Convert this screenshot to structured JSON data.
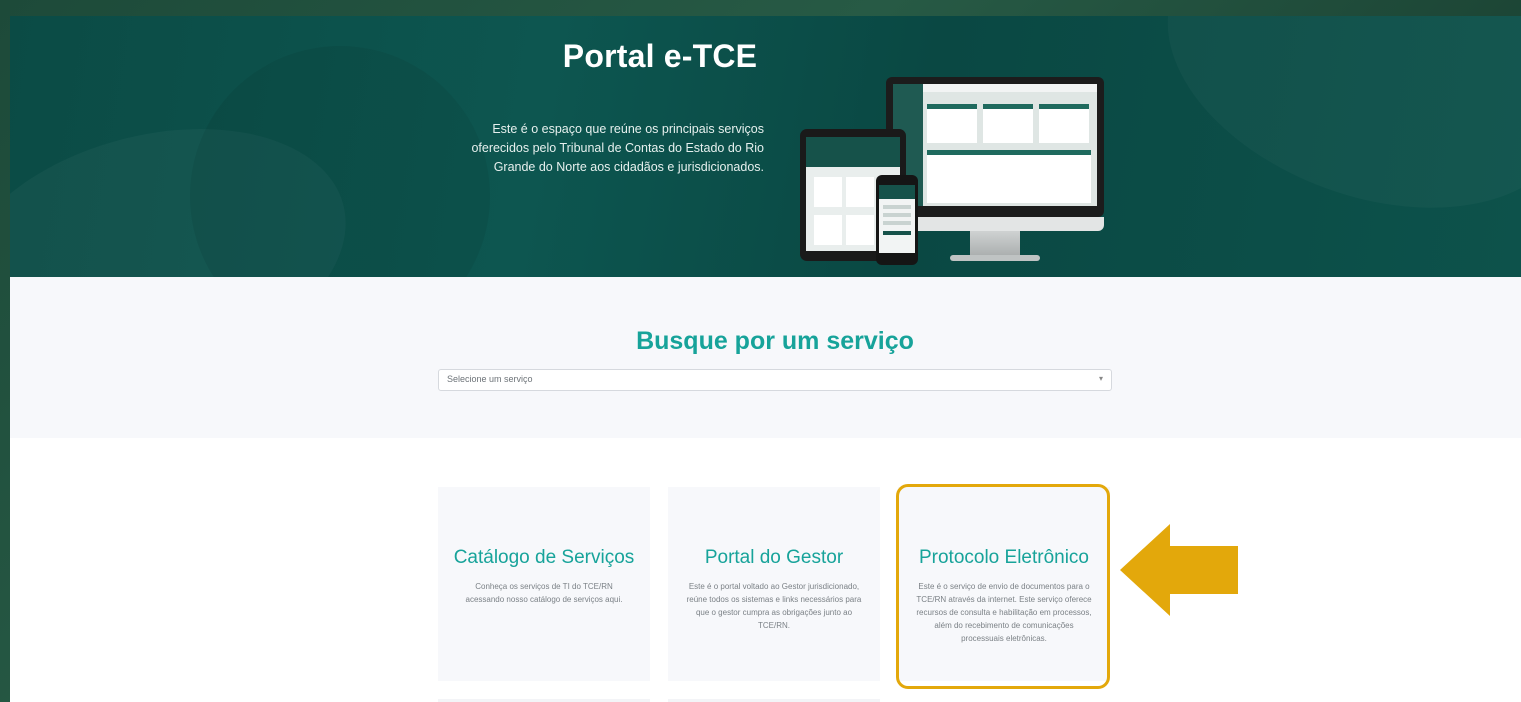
{
  "hero": {
    "title": "Portal e-TCE",
    "description": "Este é o espaço que reúne os principais serviços oferecidos pelo Tribunal de Contas do Estado do Rio Grande do Norte aos cidadãos e jurisdicionados."
  },
  "search": {
    "title": "Busque por um serviço",
    "placeholder": "Selecione um serviço",
    "caret": "▾"
  },
  "cards": [
    {
      "title": "Catálogo de Serviços",
      "description": "Conheça os serviços de TI do TCE/RN acessando nosso catálogo de serviços aqui."
    },
    {
      "title": "Portal do Gestor",
      "description": "Este é o portal voltado ao Gestor jurisdicionado, reúne todos os sistemas e links necessários para que o gestor cumpra as obrigações junto ao TCE/RN."
    },
    {
      "title": "Protocolo Eletrônico",
      "description": "Este é o serviço de envio de documentos para o TCE/RN através da internet. Este serviço oferece recursos de consulta e habilitação em processos, além do recebimento de comunicações processuais eletrônicas."
    }
  ],
  "colors": {
    "hero_bg": "#0b4b45",
    "accent_teal": "#17a39a",
    "highlight": "#e3a80b",
    "frame": "#1f4a3a"
  },
  "icons": {
    "arrow": "arrow-left-icon",
    "devices": "devices-illustration"
  }
}
